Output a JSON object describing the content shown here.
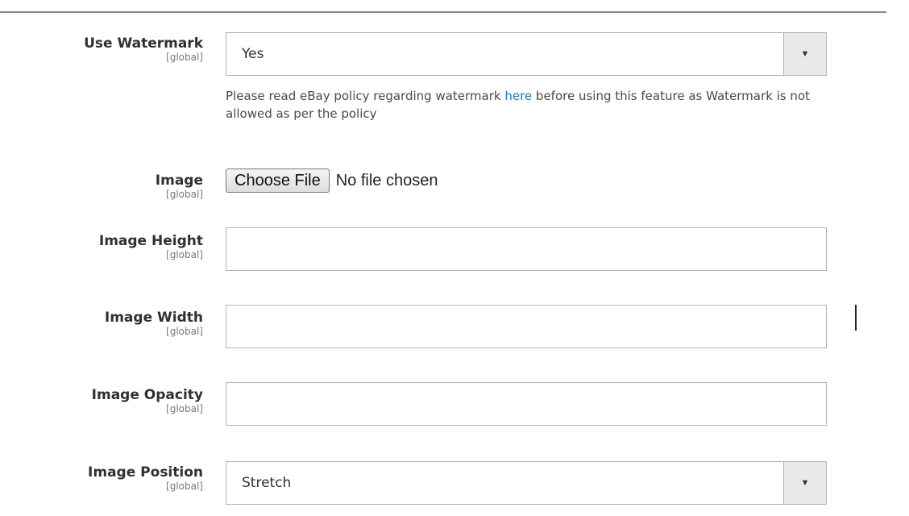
{
  "fields": {
    "use_watermark": {
      "label": "Use Watermark",
      "scope": "[global]",
      "value": "Yes",
      "arrow": "▼"
    },
    "note": {
      "before": "Please read eBay policy regarding watermark ",
      "link": "here",
      "after": " before using this feature as Watermark is not allowed as per the policy"
    },
    "image": {
      "label": "Image",
      "scope": "[global]",
      "button": "Choose File",
      "status": "No file chosen"
    },
    "image_height": {
      "label": "Image Height",
      "scope": "[global]",
      "value": ""
    },
    "image_width": {
      "label": "Image Width",
      "scope": "[global]",
      "value": ""
    },
    "image_opacity": {
      "label": "Image Opacity",
      "scope": "[global]",
      "value": ""
    },
    "image_position": {
      "label": "Image Position",
      "scope": "[global]",
      "value": "Stretch",
      "arrow": "▼"
    }
  },
  "colors": {
    "link": "#1979c3",
    "border": "#b3b3b3",
    "arrow_bg": "#e9e9e9"
  }
}
